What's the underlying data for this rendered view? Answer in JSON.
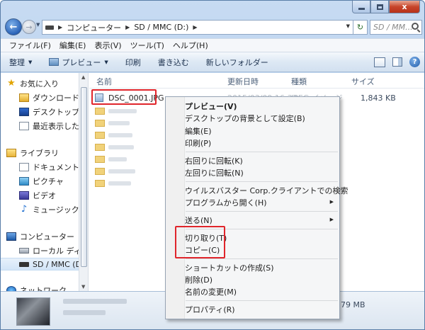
{
  "window": {
    "caption": {
      "minimize": "",
      "maximize": "",
      "close": "x"
    }
  },
  "address_bar": {
    "segments": [
      "コンピューター",
      "SD / MMC (D:)"
    ],
    "search_placeholder": "SD / MM..."
  },
  "menubar": {
    "items": [
      "ファイル(F)",
      "編集(E)",
      "表示(V)",
      "ツール(T)",
      "ヘルプ(H)"
    ]
  },
  "commandbar": {
    "organize": "整理",
    "preview": "プレビュー",
    "print": "印刷",
    "burn": "書き込む",
    "new_folder": "新しいフォルダー"
  },
  "nav_pane": {
    "favorites": "お気に入り",
    "downloads": "ダウンロード",
    "desktop": "デスクトップ",
    "recent": "最近表示した場所",
    "libraries": "ライブラリ",
    "documents": "ドキュメント",
    "pictures": "ピクチャ",
    "videos": "ビデオ",
    "music": "ミュージック",
    "computer": "コンピューター",
    "local_disk": "ローカル ディスク",
    "sd_card": "SD / MMC (D:)",
    "network": "ネットワーク"
  },
  "columns": {
    "name": "名前",
    "modified": "更新日時",
    "type": "種類",
    "size": "サイズ"
  },
  "selected_file": {
    "name": "DSC_0001.JPG",
    "modified": "2015/03/09 16:33",
    "type": "JPEG イメージ",
    "size": "1,843 KB"
  },
  "details": {
    "size_text": "79 MB"
  },
  "context_menu": {
    "preview": "プレビュー(V)",
    "set_background": "デスクトップの背景として設定(B)",
    "edit": "編集(E)",
    "print": "印刷(P)",
    "rotate_right": "右回りに回転(K)",
    "rotate_left": "左回りに回転(N)",
    "virus_scan": "ウイルスバスター Corp.クライアントでの検索",
    "open_with": "プログラムから開く(H)",
    "send_to": "送る(N)",
    "cut": "切り取り(T)",
    "copy": "コピー(C)",
    "create_shortcut": "ショートカットの作成(S)",
    "delete": "削除(D)",
    "rename": "名前の変更(M)",
    "properties": "プロパティ(R)"
  },
  "colors": {
    "highlight_border": "#e0252b",
    "window_chrome": "#b9d1ee"
  }
}
